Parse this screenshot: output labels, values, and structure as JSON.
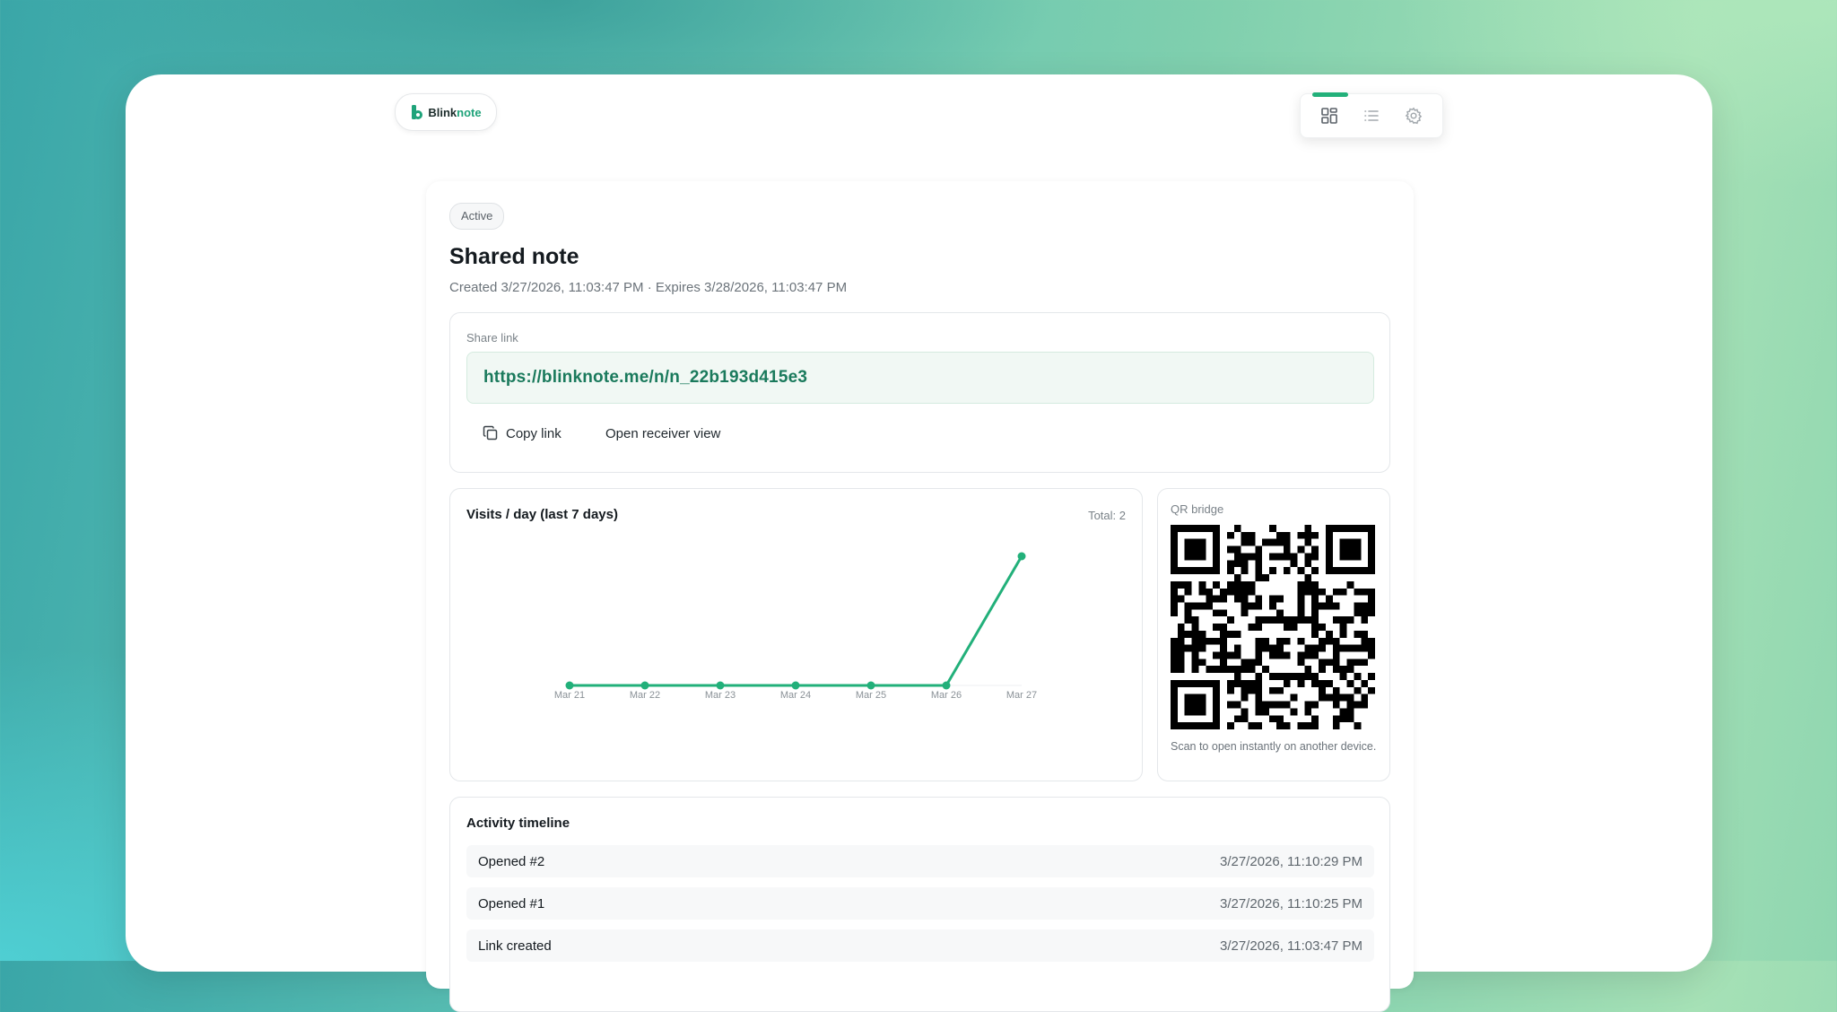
{
  "app": {
    "brand_prefix": "Blink",
    "brand_suffix": "note"
  },
  "toolbar": {
    "active_view": "grid"
  },
  "note": {
    "status": "Active",
    "title": "Shared note",
    "meta": "Created 3/27/2026, 11:03:47 PM · Expires 3/28/2026, 11:03:47 PM"
  },
  "share": {
    "label": "Share link",
    "url": "https://blinknote.me/n/n_22b193d415e3",
    "copy_label": "Copy link",
    "open_label": "Open receiver view"
  },
  "visits": {
    "title": "Visits / day (last 7 days)",
    "total_label": "Total: 2"
  },
  "chart_data": {
    "type": "line",
    "title": "Visits / day (last 7 days)",
    "categories": [
      "Mar 21",
      "Mar 22",
      "Mar 23",
      "Mar 24",
      "Mar 25",
      "Mar 26",
      "Mar 27"
    ],
    "values": [
      0,
      0,
      0,
      0,
      0,
      0,
      2
    ],
    "ylim": [
      0,
      2
    ],
    "grid": false,
    "color": "#22b07a"
  },
  "qr": {
    "label": "QR bridge",
    "caption": "Scan to open instantly on another device."
  },
  "timeline": {
    "title": "Activity timeline",
    "items": [
      {
        "event": "Opened #2",
        "time": "3/27/2026, 11:10:29 PM"
      },
      {
        "event": "Opened #1",
        "time": "3/27/2026, 11:10:25 PM"
      },
      {
        "event": "Link created",
        "time": "3/27/2026, 11:03:47 PM"
      }
    ]
  },
  "colors": {
    "accent": "#22b07a",
    "link": "#1a7a5c"
  }
}
